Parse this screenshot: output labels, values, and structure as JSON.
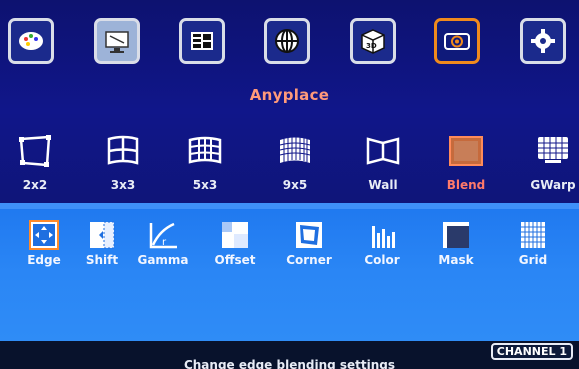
{
  "header": {
    "title": "Anyplace",
    "top_icons": [
      "palette-icon",
      "monitor-icon",
      "layout-icon",
      "globe-icon",
      "cube-icon",
      "projector-icon",
      "gear-icon"
    ],
    "active_top_index": 5
  },
  "modes": [
    {
      "label": "2x2",
      "icon": "warp-2x2-icon"
    },
    {
      "label": "3x3",
      "icon": "grid-3x3-icon"
    },
    {
      "label": "5x3",
      "icon": "grid-5x3-icon"
    },
    {
      "label": "9x5",
      "icon": "grid-9x5-icon"
    },
    {
      "label": "Wall",
      "icon": "wall-icon"
    },
    {
      "label": "Blend",
      "icon": "blend-icon"
    },
    {
      "label": "GWarp",
      "icon": "gwarp-icon"
    }
  ],
  "active_mode_index": 5,
  "functions": [
    {
      "label": "Edge",
      "icon": "edge-icon"
    },
    {
      "label": "Shift",
      "icon": "shift-icon"
    },
    {
      "label": "Gamma",
      "icon": "gamma-icon"
    },
    {
      "label": "Offset",
      "icon": "offset-icon"
    },
    {
      "label": "Corner",
      "icon": "corner-icon"
    },
    {
      "label": "Color",
      "icon": "color-icon"
    },
    {
      "label": "Mask",
      "icon": "mask-icon"
    },
    {
      "label": "Grid",
      "icon": "grid-icon"
    }
  ],
  "status": {
    "message": "Change edge blending settings",
    "channel": "CHANNEL 1"
  },
  "colors": {
    "background_top": "#0d1270",
    "panel": "#2a86f5",
    "active_border": "#f08a1d",
    "title": "#ff9a7a",
    "active_label": "#ff7a6a"
  }
}
